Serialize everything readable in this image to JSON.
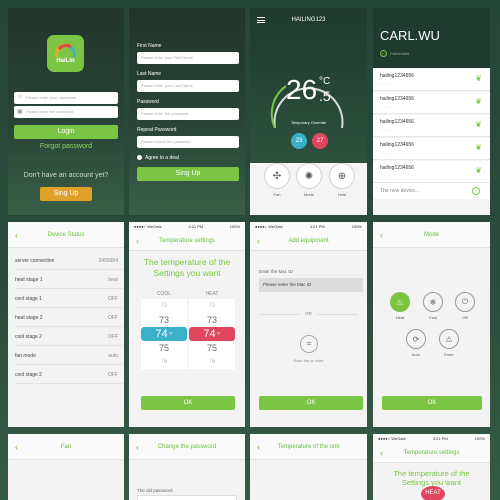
{
  "login": {
    "logo_text": "HaiLin",
    "username_placeholder": "Please enter your username",
    "password_placeholder": "Please enter the password",
    "login_button": "Login",
    "forgot_password": "Forgot password",
    "no_account_text": "Don't have an account yet?",
    "signup_button": "Sing Up"
  },
  "signup": {
    "first_name_label": "First Name",
    "first_name_placeholder": "Please enter your First Name",
    "last_name_label": "Last Name",
    "last_name_placeholder": "Please enter your Last Name",
    "password_label": "Password",
    "password_placeholder": "Please enter the password",
    "repeat_label": "Repeat Password",
    "repeat_placeholder": "Please repeat the password",
    "agree_text": "Agree to a deal",
    "signup_button": "Sing Up"
  },
  "thermostat": {
    "title": "HAILING123",
    "temp_int": "26",
    "temp_unit": "°C",
    "temp_dec": ".5",
    "mode_label": "Temporary Override",
    "cool_set": "23",
    "heat_set": "27",
    "fan_label": "Fan",
    "mode_btn_label": "Mode",
    "hold_label": "Hold",
    "colors": {
      "cool": "#3bb1c9",
      "heat": "#e0475e",
      "accent": "#7cc444"
    }
  },
  "devices": {
    "user_name": "CARL.WU",
    "user_unit": "Fahrenheit",
    "items": [
      "hailing1234656",
      "hailing1234656",
      "hailing1234656",
      "hailing1234656",
      "hailing1234656"
    ],
    "new_device_label": "The new device..."
  },
  "device_status": {
    "title": "Device Status",
    "rows": [
      {
        "label": "server connection",
        "value": "2455654"
      },
      {
        "label": "heat stage 1",
        "value": "heat"
      },
      {
        "label": "cool stage 1",
        "value": "OFF"
      },
      {
        "label": "heat stage 2",
        "value": "OFF"
      },
      {
        "label": "cool stage 2",
        "value": "OFF"
      },
      {
        "label": "fan mode",
        "value": "auto"
      },
      {
        "label": "cool stage 2",
        "value": "OFF"
      }
    ]
  },
  "temp_settings": {
    "status_carrier": "●●●●○ WeGate",
    "status_time": "4:21 PM",
    "status_battery": "100%",
    "title": "Temperature settings",
    "headline": "The temperature of the Settings you want",
    "cool_label": "COOL",
    "heat_label": "HEAT",
    "cool_values": [
      "72",
      "73",
      "74",
      "75",
      "76"
    ],
    "heat_values": [
      "72",
      "73",
      "74",
      "75",
      "76"
    ],
    "unit": "°F",
    "ok_button": "OK"
  },
  "add_equipment": {
    "status_carrier": "●●●●○ WeGate",
    "status_time": "4:21 PM",
    "status_battery": "100%",
    "title": "Add equipment",
    "mac_label": "Enter the Mac ID",
    "mac_placeholder": "Please enter the Mac ID",
    "or_label": "OR",
    "scan_label": "Scan the qr code",
    "ok_button": "OK"
  },
  "mode": {
    "title": "Mode",
    "heat": "Heat",
    "cool": "Cool",
    "off": "Off",
    "auto": "Auto",
    "emer": "Emer",
    "ok_button": "OK"
  },
  "fan": {
    "title": "Fan"
  },
  "change_password": {
    "title": "Change the password",
    "old_label": "The old password"
  },
  "temp_unit": {
    "title": "Temperature of the unit"
  },
  "temp_settings2": {
    "status_carrier": "●●●●○ WeGate",
    "status_time": "4:21 PM",
    "status_battery": "100%",
    "title": "Temperature settings",
    "headline": "The temperature of the Settings you want",
    "heat_badge": "HEAT"
  }
}
